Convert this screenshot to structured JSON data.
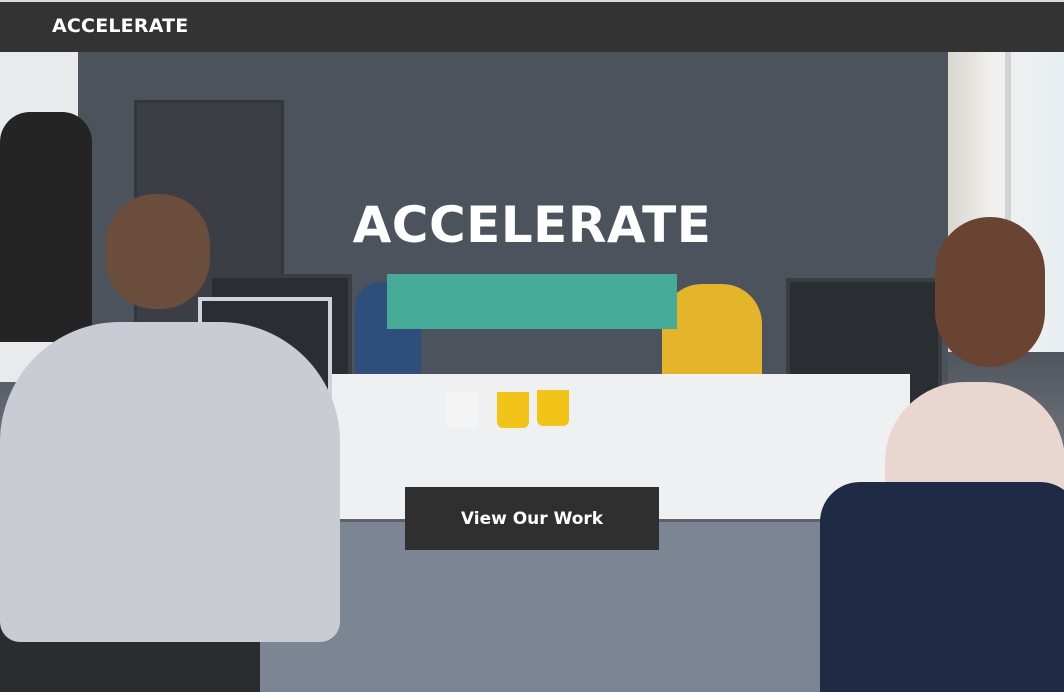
{
  "navbar": {
    "brand": "ACCELERATE"
  },
  "hero": {
    "title": "ACCELERATE",
    "accent_color": "#45ab98",
    "cta_label": "View Our Work",
    "background_image": "office-team-photo"
  },
  "colors": {
    "navbar_bg": "#333333",
    "button_bg": "#2f2f2f",
    "text": "#ffffff"
  }
}
